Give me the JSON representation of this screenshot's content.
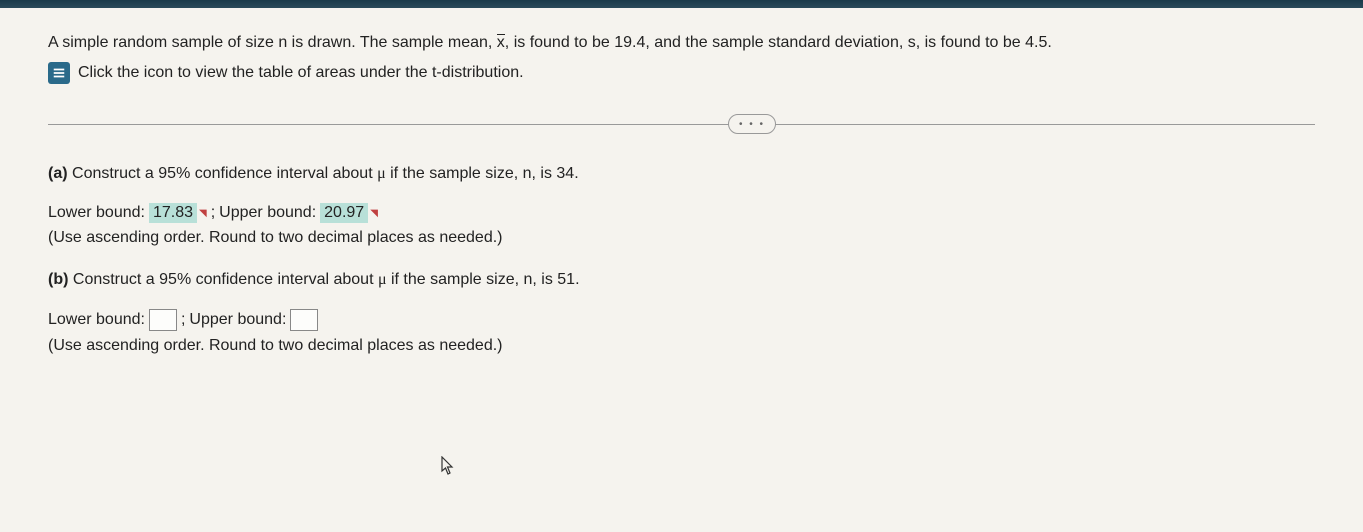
{
  "intro": {
    "text_before_xbar": "A simple random sample of size n is drawn. The sample mean, ",
    "xbar": "x",
    "text_after_xbar": ", is found to be 19.4, and the sample standard deviation, s, is found to be 4.5.",
    "icon_text": "Click the icon to view the table of areas under the t-distribution."
  },
  "more_button": "• • •",
  "part_a": {
    "label": "(a)",
    "question_before_mu": " Construct a 95% confidence interval about ",
    "mu": "μ",
    "question_after_mu": " if the sample size, n, is 34.",
    "lower_label": "Lower bound: ",
    "lower_value": "17.83",
    "separator": " ; ",
    "upper_label": "Upper bound: ",
    "upper_value": "20.97",
    "instruction": "(Use ascending order. Round to two decimal places as needed.)"
  },
  "part_b": {
    "label": "(b)",
    "question_before_mu": " Construct a 95% confidence interval about ",
    "mu": "μ",
    "question_after_mu": " if the sample size, n, is 51.",
    "lower_label": "Lower bound: ",
    "separator": " ; ",
    "upper_label": "Upper bound: ",
    "instruction": "(Use ascending order. Round to two decimal places as needed.)"
  }
}
